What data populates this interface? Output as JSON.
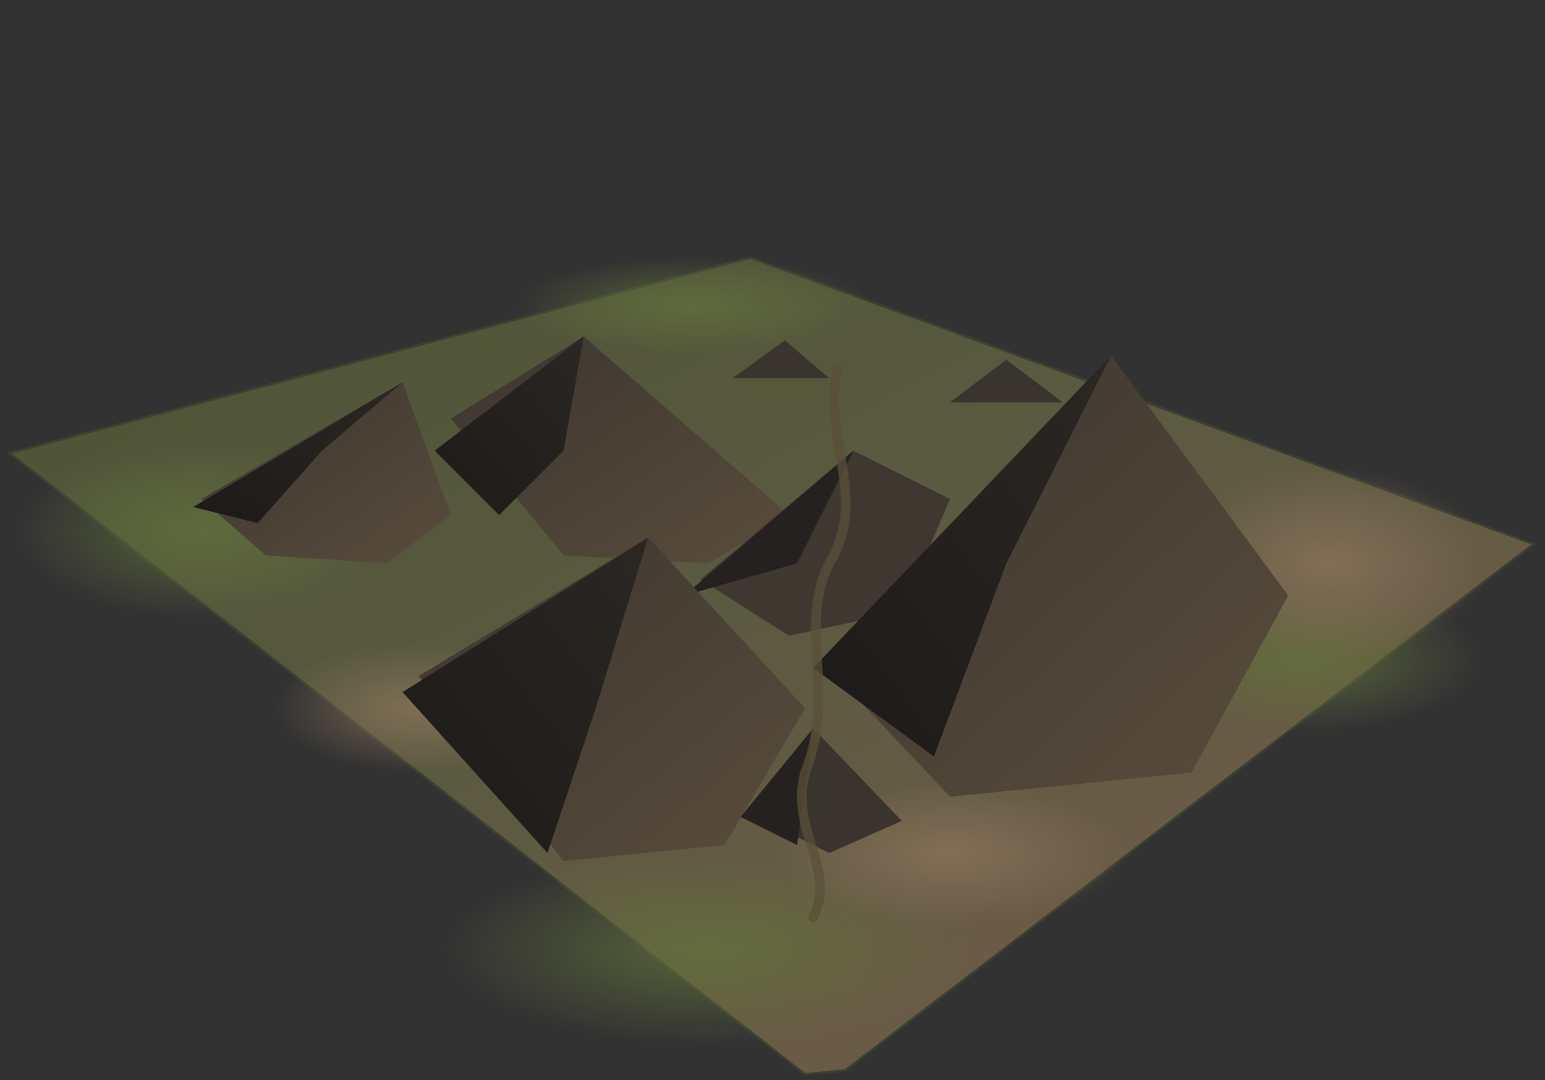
{
  "viewport": {
    "background_color": "#323232"
  },
  "terrain": {
    "ground_color": "#4a5232",
    "grass_color": "#56603a",
    "dirt_color": "#6a5a46",
    "rock_color": "#3e3731",
    "shadow_color": "#1d1b19",
    "edge_color": "#3b4030"
  }
}
